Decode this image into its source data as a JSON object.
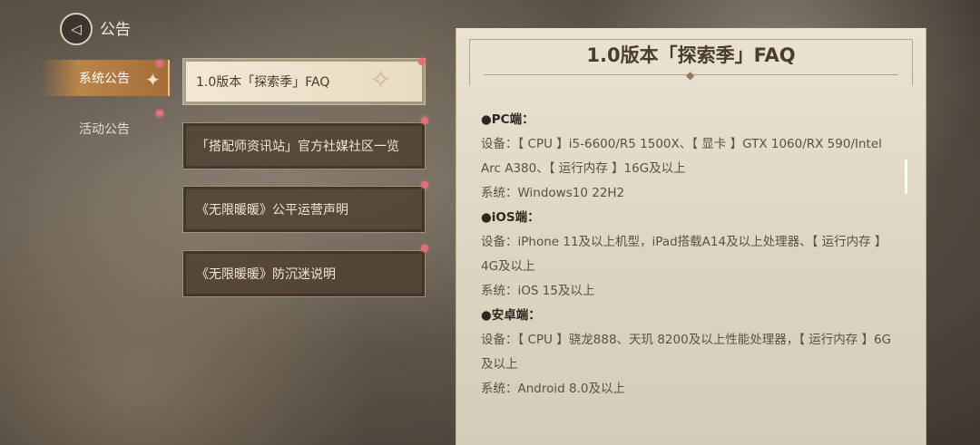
{
  "header": {
    "title": "公告",
    "back_icon": "back-arrow-icon"
  },
  "nav": {
    "items": [
      {
        "label": "系统公告",
        "active": true
      },
      {
        "label": "活动公告",
        "active": false
      }
    ]
  },
  "announcements": [
    {
      "label": "1.0版本「探索季」FAQ",
      "selected": true
    },
    {
      "label": "「搭配师资讯站」官方社媒社区一览",
      "selected": false
    },
    {
      "label": "《无限暖暖》公平运营声明",
      "selected": false
    },
    {
      "label": "《无限暖暖》防沉迷说明",
      "selected": false
    }
  ],
  "detail": {
    "title": "1.0版本「探索季」FAQ",
    "lines": {
      "pc_head": "●PC端：",
      "pc_device": "设备：【 CPU 】i5-6600/R5 1500X、【 显卡 】GTX 1060/RX 590/Intel Arc A380、【 运行内存 】16G及以上",
      "pc_system": "系统：Windows10 22H2",
      "ios_head": "●iOS端：",
      "ios_device": "设备：iPhone 11及以上机型，iPad搭载A14及以上处理器、【 运行内存 】4G及以上",
      "ios_system": "系统：iOS 15及以上",
      "android_head": "●安卓端：",
      "android_device": "设备：【 CPU 】骁龙888、天玑 8200及以上性能处理器，【 运行内存 】6G及以上",
      "android_system": "系统：Android 8.0及以上"
    }
  },
  "colors": {
    "accent": "#c88c46",
    "badge": "#e0707a",
    "panel": "#e6ddcc"
  }
}
